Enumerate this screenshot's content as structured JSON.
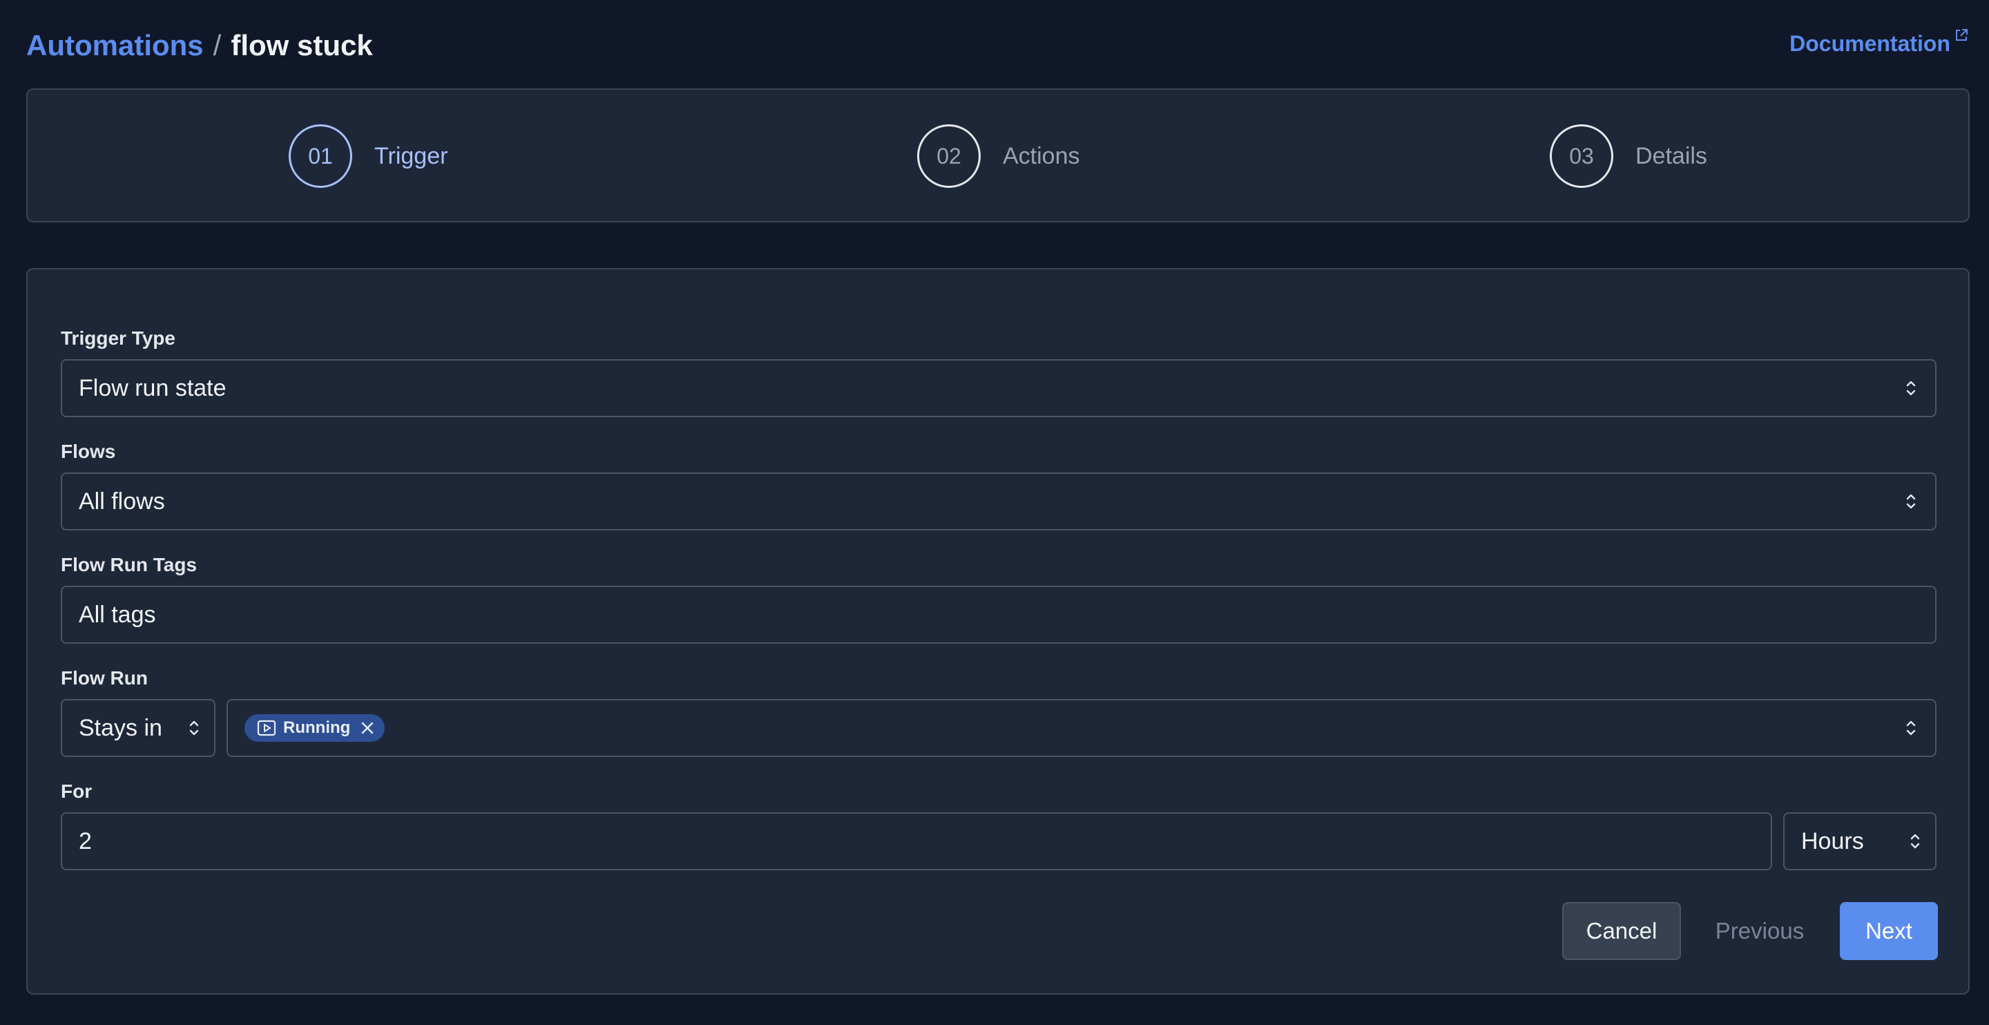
{
  "breadcrumb": {
    "root": "Automations",
    "separator": "/",
    "current": "flow stuck"
  },
  "documentation_link": "Documentation",
  "steps": [
    {
      "number": "01",
      "label": "Trigger",
      "active": true
    },
    {
      "number": "02",
      "label": "Actions",
      "active": false
    },
    {
      "number": "03",
      "label": "Details",
      "active": false
    }
  ],
  "form": {
    "trigger_type": {
      "label": "Trigger Type",
      "value": "Flow run state"
    },
    "flows": {
      "label": "Flows",
      "value": "All flows"
    },
    "flow_run_tags": {
      "label": "Flow Run Tags",
      "value": "All tags"
    },
    "flow_run": {
      "label": "Flow Run",
      "posture": "Stays in",
      "states": [
        "Running"
      ]
    },
    "for": {
      "label": "For",
      "value": "2",
      "unit": "Hours"
    }
  },
  "buttons": {
    "cancel": "Cancel",
    "previous": "Previous",
    "next": "Next"
  },
  "colors": {
    "accent": "#5b8def",
    "active_step": "#a7c0f7",
    "running_chip": "#2e4f94",
    "background": "#101729",
    "card": "#1e2738"
  }
}
